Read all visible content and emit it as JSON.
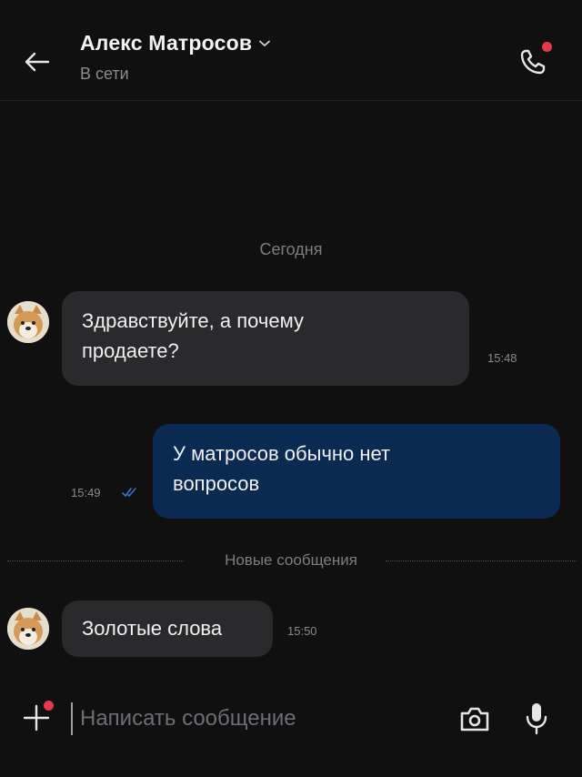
{
  "header": {
    "contact_name": "Алекс Матросов",
    "status": "В сети",
    "back_icon": "arrow-left-icon",
    "call_icon": "phone-icon"
  },
  "chat": {
    "date_separator": "Сегодня",
    "messages": [
      {
        "direction": "in",
        "lines": [
          "Здравствуйте, а почему",
          "продаете?"
        ],
        "time": "15:48"
      },
      {
        "direction": "out",
        "lines": [
          "У матросов обычно нет",
          "вопросов"
        ],
        "time": "15:49",
        "read": true
      },
      {
        "direction": "in",
        "lines": [
          "Золотые слова"
        ],
        "time": "15:50"
      }
    ],
    "new_messages_label": "Новые сообщения"
  },
  "composer": {
    "placeholder": "Написать сообщение",
    "value": ""
  },
  "colors": {
    "background": "#101011",
    "incoming_bubble": "#2a2a2d",
    "outgoing_bubble": "#0b2a52",
    "accent_dot": "#e8394b",
    "read_check": "#3b6fd6"
  }
}
